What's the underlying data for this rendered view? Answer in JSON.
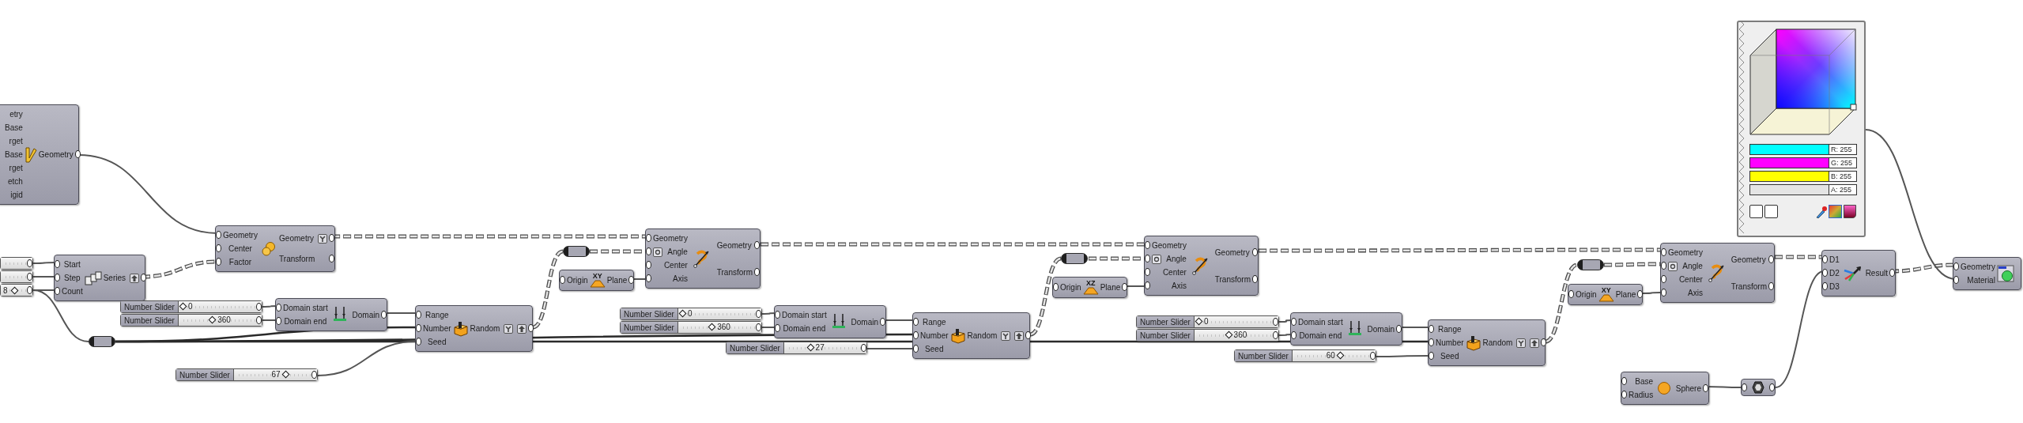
{
  "canvas": {
    "nodes": [
      {
        "kind": "component",
        "inputs": [
          "etry",
          "Base",
          "rget",
          "Base",
          "rget",
          "etch",
          "igid"
        ],
        "outputs": [
          "Geometry"
        ]
      },
      {
        "kind": "component",
        "inputs": [
          "Geometry",
          "Center",
          "Factor"
        ],
        "outputs": [
          "Geometry",
          "Transform"
        ],
        "flatten": true
      },
      {
        "kind": "slider"
      },
      {
        "kind": "slider"
      },
      {
        "kind": "slider",
        "value": "8"
      },
      {
        "kind": "component",
        "inputs": [
          "Start",
          "Step",
          "Count"
        ],
        "outputs": [
          "Series"
        ],
        "graft": true
      },
      {
        "kind": "slider",
        "label": "Number Slider",
        "value": "0",
        "level": 0
      },
      {
        "kind": "slider",
        "label": "Number Slider",
        "value": "360",
        "level": 0.4
      },
      {
        "kind": "component",
        "inputs": [
          "Domain start",
          "Domain end"
        ],
        "outputs": [
          "Domain"
        ]
      },
      {
        "kind": "relay"
      },
      {
        "kind": "slider",
        "label": "Number Slider",
        "value": "67",
        "level": 0.64
      },
      {
        "kind": "component",
        "inputs": [
          "Range",
          "Number",
          "Seed"
        ],
        "outputs": [
          "Random"
        ],
        "flatten": true,
        "graft": true
      },
      {
        "kind": "relay"
      },
      {
        "kind": "plane",
        "label": "XY",
        "inputs": [
          "Origin"
        ],
        "outputs": [
          "Plane"
        ]
      },
      {
        "kind": "component",
        "inputs": [
          "Geometry",
          "Angle",
          "Center",
          "Axis"
        ],
        "outputs": [
          "Geometry",
          "Transform"
        ],
        "degrees": true
      },
      {
        "kind": "slider",
        "label": "Number Slider",
        "value": "0",
        "level": 0
      },
      {
        "kind": "slider",
        "label": "Number Slider",
        "value": "360",
        "level": 0.4
      },
      {
        "kind": "component",
        "inputs": [
          "Domain start",
          "Domain end"
        ],
        "outputs": [
          "Domain"
        ]
      },
      {
        "kind": "slider",
        "label": "Number Slider",
        "value": "27",
        "level": 0.3
      },
      {
        "kind": "component",
        "inputs": [
          "Range",
          "Number",
          "Seed"
        ],
        "outputs": [
          "Random"
        ],
        "flatten": true,
        "graft": true
      },
      {
        "kind": "relay"
      },
      {
        "kind": "plane",
        "label": "XZ",
        "inputs": [
          "Origin"
        ],
        "outputs": [
          "Plane"
        ]
      },
      {
        "kind": "component",
        "inputs": [
          "Geometry",
          "Angle",
          "Center",
          "Axis"
        ],
        "outputs": [
          "Geometry",
          "Transform"
        ],
        "degrees": true
      },
      {
        "kind": "slider",
        "label": "Number Slider",
        "value": "0",
        "level": 0
      },
      {
        "kind": "slider",
        "label": "Number Slider",
        "value": "360",
        "level": 0.4
      },
      {
        "kind": "component",
        "inputs": [
          "Domain start",
          "Domain end"
        ],
        "outputs": [
          "Domain"
        ]
      },
      {
        "kind": "slider",
        "label": "Number Slider",
        "value": "60",
        "level": 0.59
      },
      {
        "kind": "component",
        "inputs": [
          "Range",
          "Number",
          "Seed"
        ],
        "outputs": [
          "Random"
        ],
        "flatten": true,
        "graft": true
      },
      {
        "kind": "relay"
      },
      {
        "kind": "plane",
        "label": "XY",
        "inputs": [
          "Origin"
        ],
        "outputs": [
          "Plane"
        ]
      },
      {
        "kind": "component",
        "inputs": [
          "Geometry",
          "Angle",
          "Center",
          "Axis"
        ],
        "outputs": [
          "Geometry",
          "Transform"
        ],
        "degrees": true
      },
      {
        "kind": "swatch",
        "channels": [
          {
            "label": "R: 255",
            "color": "#00ffff"
          },
          {
            "label": "G: 255",
            "color": "#ff00ff"
          },
          {
            "label": "B: 255",
            "color": "#ffff00"
          },
          {
            "label": "A: 255",
            "color": "#e4e4e4"
          }
        ]
      },
      {
        "kind": "component",
        "inputs": [
          "D1",
          "D2",
          "D3"
        ],
        "outputs": [
          "Result"
        ]
      },
      {
        "kind": "component",
        "inputs": [
          "Geometry",
          "Material"
        ]
      },
      {
        "kind": "component",
        "inputs": [
          "Base",
          "Radius"
        ],
        "outputs": [
          "Sphere"
        ]
      },
      {
        "kind": "param"
      }
    ]
  }
}
